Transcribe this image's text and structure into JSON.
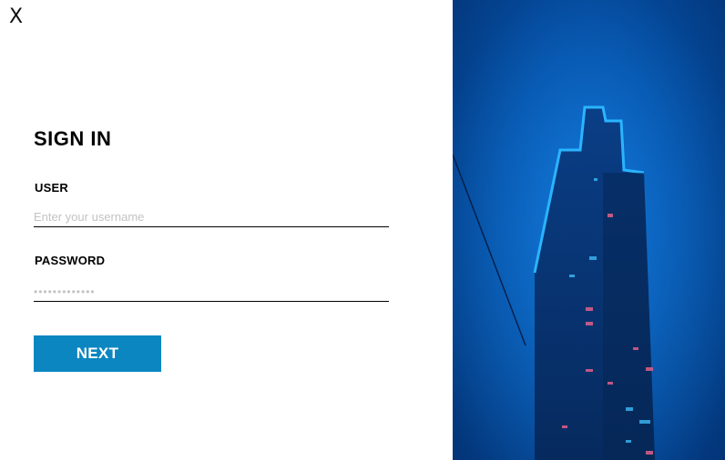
{
  "close": {
    "label": "X"
  },
  "signin": {
    "title": "SIGN IN",
    "user_label": "USER",
    "user_placeholder": "Enter your username",
    "password_label": "PASSWORD",
    "password_placeholder": "•••••••••••••",
    "next_label": "NEXT"
  },
  "colors": {
    "button_bg": "#0b86c1",
    "background": "#ffffff",
    "hero_blue": "#0a68c9"
  },
  "hero": {
    "subject": "skyscraper-in-blue-fog"
  }
}
